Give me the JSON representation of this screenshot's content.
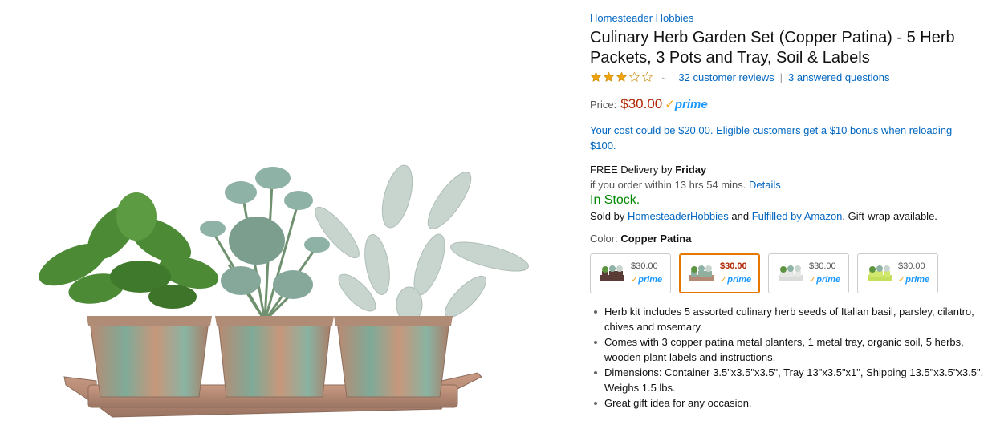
{
  "product": {
    "brand": "Homesteader Hobbies",
    "title": "Culinary Herb Garden Set (Copper Patina) - 5 Herb Packets, 3 Pots and Tray, Soil & Labels",
    "rating_stars": 3,
    "rating_max": 5,
    "reviews_link": "32 customer reviews",
    "separator": "|",
    "questions_link": "3 answered questions",
    "price_label": "Price:",
    "price": "$30.00",
    "prime_check": "✓",
    "prime_word": "prime",
    "promo": "Your cost could be $20.00. Eligible customers get a $10 bonus when reloading $100."
  },
  "delivery": {
    "free_prefix": "FREE Delivery by",
    "day": "Friday",
    "order_text": "if you order within 13 hrs 54 mins.",
    "details_link": "Details",
    "stock": "In Stock.",
    "sold_prefix": "Sold by",
    "seller_link": "HomesteaderHobbies",
    "and_text": "and",
    "fulfilled_link": "Fulfilled by Amazon",
    "giftwrap_text": ". Gift-wrap available."
  },
  "color": {
    "label": "Color:",
    "value": "Copper Patina",
    "swatches": [
      {
        "price": "$30.00",
        "prime": "prime",
        "selected": false
      },
      {
        "price": "$30.00",
        "prime": "prime",
        "selected": true
      },
      {
        "price": "$30.00",
        "prime": "prime",
        "selected": false
      },
      {
        "price": "$30.00",
        "prime": "prime",
        "selected": false
      }
    ]
  },
  "bullets": [
    "Herb kit includes 5 assorted culinary herb seeds of Italian basil, parsley, cilantro, chives and rosemary.",
    "Comes with 3 copper patina metal planters, 1 metal tray, organic soil, 5 herbs, wooden plant labels and instructions.",
    "Dimensions: Container 3.5\"x3.5\"x3.5\", Tray 13\"x3.5\"x1\", Shipping 13.5\"x3.5\"x3.5\". Weighs 1.5 lbs.",
    "Great gift idea for any occasion."
  ],
  "colors": {
    "link": "#0066c0",
    "price": "#b12704",
    "in_stock": "#008a00",
    "prime_blue": "#1a98ff",
    "prime_orange": "#f7a11c",
    "star": "#f0a30a",
    "selected_border": "#e77600"
  }
}
